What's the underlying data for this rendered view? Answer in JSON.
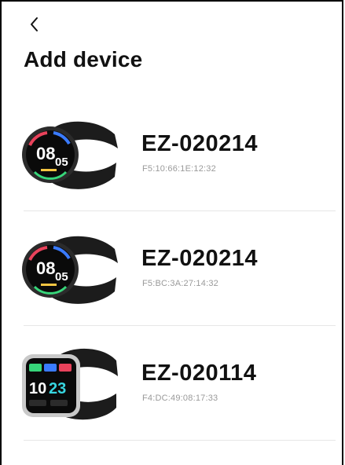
{
  "header": {
    "back_icon": "chevron-left-icon",
    "title": "Add device"
  },
  "devices": [
    {
      "name": "EZ-020214",
      "mac": "F5:10:66:1E:12:32",
      "image": "round-smartwatch-image",
      "time": "08",
      "minute": "05"
    },
    {
      "name": "EZ-020214",
      "mac": "F5:BC:3A:27:14:32",
      "image": "round-smartwatch-image",
      "time": "08",
      "minute": "05"
    },
    {
      "name": "EZ-020114",
      "mac": "F4:DC:49:08:17:33",
      "image": "square-smartwatch-image",
      "time": "10",
      "minute": "23"
    }
  ],
  "colors": {
    "background": "#ffffff",
    "title": "#111111",
    "mac_text": "#9a9a9a",
    "divider": "#e6e6e6"
  }
}
